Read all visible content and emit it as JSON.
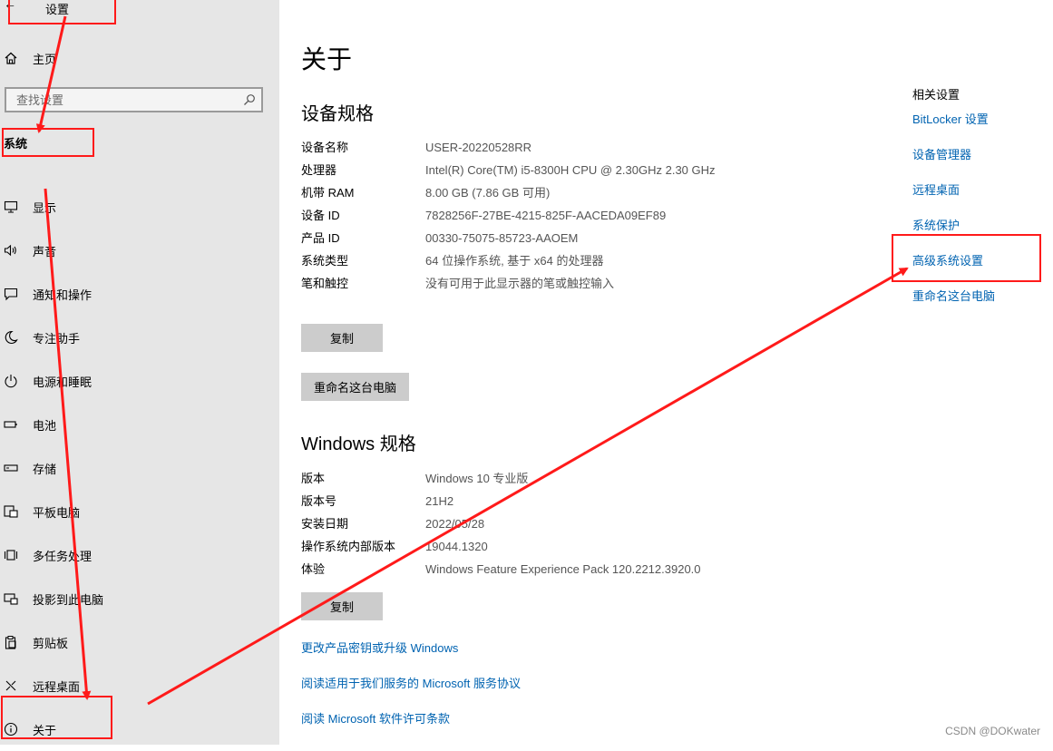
{
  "app": {
    "title": "设置",
    "back_glyph": "←"
  },
  "sidebar": {
    "home_label": "主页",
    "search_placeholder": "查找设置",
    "section_label": "系统",
    "items": [
      {
        "label": "显示",
        "icon": "monitor-icon"
      },
      {
        "label": "声音",
        "icon": "speaker-icon"
      },
      {
        "label": "通知和操作",
        "icon": "notification-icon"
      },
      {
        "label": "专注助手",
        "icon": "moon-icon"
      },
      {
        "label": "电源和睡眠",
        "icon": "power-icon"
      },
      {
        "label": "电池",
        "icon": "battery-icon"
      },
      {
        "label": "存储",
        "icon": "storage-icon"
      },
      {
        "label": "平板电脑",
        "icon": "tablet-icon"
      },
      {
        "label": "多任务处理",
        "icon": "multitask-icon"
      },
      {
        "label": "投影到此电脑",
        "icon": "project-icon"
      },
      {
        "label": "剪贴板",
        "icon": "clipboard-icon"
      },
      {
        "label": "远程桌面",
        "icon": "remote-desktop-icon"
      },
      {
        "label": "关于",
        "icon": "info-icon"
      }
    ]
  },
  "main": {
    "title": "关于",
    "device_specs": {
      "heading": "设备规格",
      "rows": [
        {
          "label": "设备名称",
          "value": "USER-20220528RR"
        },
        {
          "label": "处理器",
          "value": "Intel(R) Core(TM) i5-8300H CPU @ 2.30GHz   2.30 GHz"
        },
        {
          "label": "机带 RAM",
          "value": "8.00 GB (7.86 GB 可用)"
        },
        {
          "label": "设备 ID",
          "value": "7828256F-27BE-4215-825F-AACEDA09EF89"
        },
        {
          "label": "产品 ID",
          "value": "00330-75075-85723-AAOEM"
        },
        {
          "label": "系统类型",
          "value": "64 位操作系统, 基于 x64 的处理器"
        },
        {
          "label": "笔和触控",
          "value": "没有可用于此显示器的笔或触控输入"
        }
      ],
      "copy_button": "复制",
      "rename_button": "重命名这台电脑"
    },
    "windows_specs": {
      "heading": "Windows 规格",
      "rows": [
        {
          "label": "版本",
          "value": "Windows 10 专业版"
        },
        {
          "label": "版本号",
          "value": "21H2"
        },
        {
          "label": "安装日期",
          "value": "2022/05/28"
        },
        {
          "label": "操作系统内部版本",
          "value": "19044.1320"
        },
        {
          "label": "体验",
          "value": "Windows Feature Experience Pack 120.2212.3920.0"
        }
      ],
      "copy_button": "复制"
    },
    "links": [
      "更改产品密钥或升级 Windows",
      "阅读适用于我们服务的 Microsoft 服务协议",
      "阅读 Microsoft 软件许可条款"
    ]
  },
  "related": {
    "title": "相关设置",
    "links": [
      "BitLocker 设置",
      "设备管理器",
      "远程桌面",
      "系统保护",
      "高级系统设置",
      "重命名这台电脑"
    ]
  },
  "annotation": {
    "color": "#ff1a1a"
  },
  "watermark": "CSDN @DOKwater"
}
